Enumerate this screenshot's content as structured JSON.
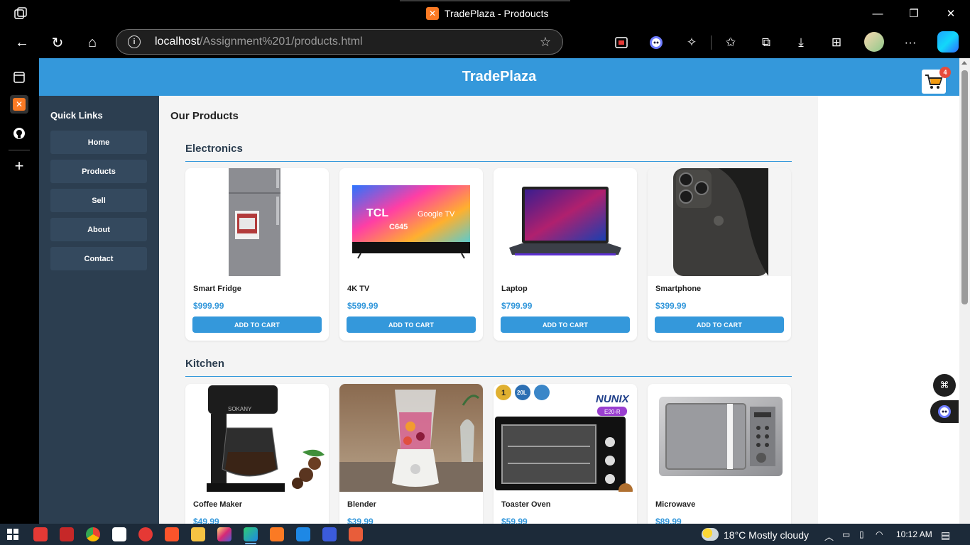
{
  "browser": {
    "window_title": "TradePlaza - Prodoucts",
    "address": {
      "host": "localhost",
      "path": "/Assignment%201/products.html"
    }
  },
  "site": {
    "brand": "TradePlaza",
    "cart_count": "4",
    "sidebar_heading": "Quick Links",
    "nav": [
      {
        "label": "Home"
      },
      {
        "label": "Products"
      },
      {
        "label": "Sell"
      },
      {
        "label": "About"
      },
      {
        "label": "Contact"
      }
    ],
    "page_heading": "Our Products",
    "add_label": "ADD TO CART",
    "categories": [
      {
        "title": "Electronics",
        "products": [
          {
            "name": "Smart Fridge",
            "price": "$999.99"
          },
          {
            "name": "4K TV",
            "price": "$599.99"
          },
          {
            "name": "Laptop",
            "price": "$799.99"
          },
          {
            "name": "Smartphone",
            "price": "$399.99"
          }
        ]
      },
      {
        "title": "Kitchen",
        "products": [
          {
            "name": "Coffee Maker",
            "price": "$49.99"
          },
          {
            "name": "Blender",
            "price": "$39.99"
          },
          {
            "name": "Toaster Oven",
            "price": "$59.99"
          },
          {
            "name": "Microwave",
            "price": "$89.99"
          }
        ]
      }
    ],
    "image_text": {
      "tv_brand": "TCL",
      "tv_model": "C645",
      "tv_os": "Google TV",
      "coffee_brand": "SOKANY",
      "oven_brand": "NUNIX",
      "oven_model": "E20-R",
      "oven_capacity": "20L"
    }
  },
  "taskbar": {
    "weather": "18°C  Mostly cloudy",
    "time": "10:12 AM"
  },
  "colors": {
    "header": "#3498db",
    "sidebar": "#2c3e50",
    "button": "#3498db"
  }
}
